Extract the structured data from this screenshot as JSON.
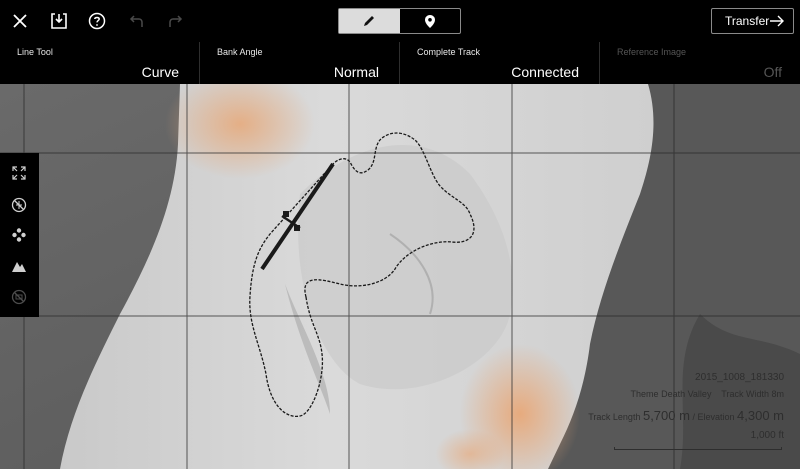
{
  "toolbar": {
    "close_icon": "close-icon",
    "save_icon": "save-download-icon",
    "help_icon": "help-icon",
    "undo_icon": "undo-icon",
    "redo_icon": "redo-icon",
    "modes": [
      {
        "icon": "pencil-icon",
        "active": true
      },
      {
        "icon": "location-pin-icon",
        "active": false
      }
    ],
    "transfer_label": "Transfer"
  },
  "settings": [
    {
      "label": "Line Tool",
      "value": "Curve",
      "enabled": true
    },
    {
      "label": "Bank Angle",
      "value": "Normal",
      "enabled": true
    },
    {
      "label": "Complete Track",
      "value": "Connected",
      "enabled": true
    },
    {
      "label": "Reference Image",
      "value": "Off",
      "enabled": false
    }
  ],
  "rail": {
    "icons": [
      "expand-icon",
      "no-flight-icon",
      "waypoints-icon",
      "terrain-icon",
      "disabled-layer-icon"
    ]
  },
  "info": {
    "date_id": "2015_1008_181330",
    "theme_label": "Theme",
    "theme_value": "Death Valley",
    "width_label": "Track Width",
    "width_value": "8m",
    "length_label": "Track Length",
    "length_value": "5,700 m",
    "elevation_label": "/ Elevation",
    "elevation_value": "4,300 m",
    "scale_label": "1,000 ft"
  },
  "colors": {
    "background": "#000000",
    "map_dark": "#5e5e5e",
    "map_light": "#d4d4d4",
    "sand": "#e7a878",
    "mode_active": "#dcdcdc"
  }
}
